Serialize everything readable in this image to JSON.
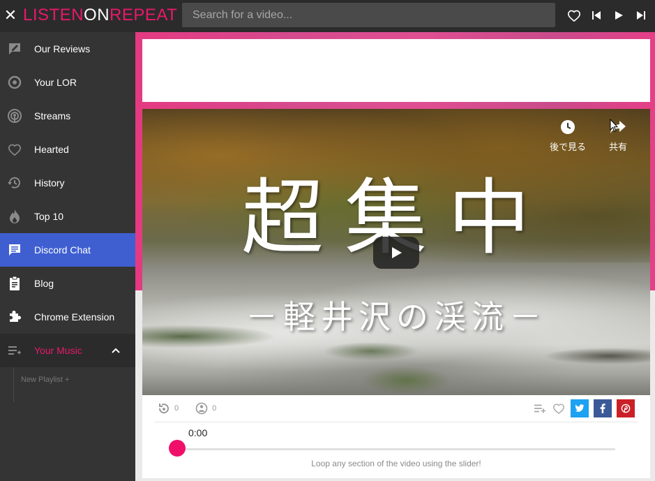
{
  "header": {
    "logo_left": "LISTEN",
    "logo_on": "ON",
    "logo_right": "REPEAT",
    "search_placeholder": "Search for a video..."
  },
  "sidebar": {
    "items": [
      {
        "label": "Our Reviews",
        "icon": "rate-review-icon"
      },
      {
        "label": "Your LOR",
        "icon": "loop-icon"
      },
      {
        "label": "Streams",
        "icon": "podcast-icon"
      },
      {
        "label": "Hearted",
        "icon": "heart-icon"
      },
      {
        "label": "History",
        "icon": "history-icon"
      },
      {
        "label": "Top 10",
        "icon": "flame-icon"
      },
      {
        "label": "Discord Chat",
        "icon": "chat-icon"
      },
      {
        "label": "Blog",
        "icon": "clipboard-icon"
      },
      {
        "label": "Chrome Extension",
        "icon": "puzzle-icon"
      }
    ],
    "active_index": 6,
    "your_music_label": "Your Music",
    "new_playlist_label": "New Playlist +"
  },
  "video": {
    "title_main": "超集中",
    "title_sub": "－軽井沢の渓流－",
    "watch_later_label": "後で見る",
    "share_label": "共有"
  },
  "controls": {
    "repeat_count": "0",
    "listeners_count": "0",
    "time": "0:00",
    "hint": "Loop any section of the video using the slider!"
  },
  "colors": {
    "accent": "#e8196a",
    "active_nav": "#3f5fd1",
    "twitter": "#1da1f2",
    "facebook": "#3b5998",
    "pinterest": "#cb2027"
  }
}
